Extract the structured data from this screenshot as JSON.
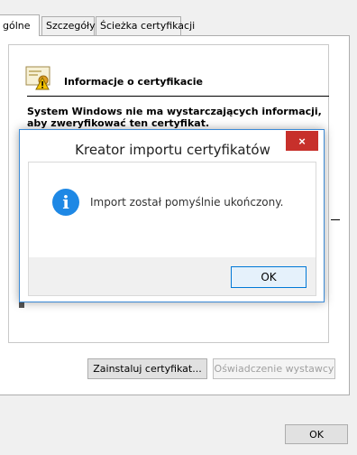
{
  "tabs": [
    {
      "label": "gólne"
    },
    {
      "label": "Szczegóły"
    },
    {
      "label": "Ścieżka certyfikacji"
    }
  ],
  "info": {
    "heading": "Informacje o certyfikacie",
    "message_line1": "System Windows nie ma wystarczających informacji,",
    "message_line2": "aby zweryfikować ten certyfikat."
  },
  "buttons": {
    "install": "Zainstaluj certyfikat...",
    "issuer_statement": "Oświadczenie wystawcy",
    "ok": "OK"
  },
  "dialog": {
    "title": "Kreator importu certyfikatów",
    "close_glyph": "×",
    "icon_glyph": "i",
    "message": "Import został pomyślnie ukończony.",
    "ok": "OK"
  },
  "colors": {
    "dialog_border": "#3b8ad6",
    "close_button": "#c7302b",
    "info_icon": "#1e88e5",
    "default_button_border": "#0078d7"
  }
}
